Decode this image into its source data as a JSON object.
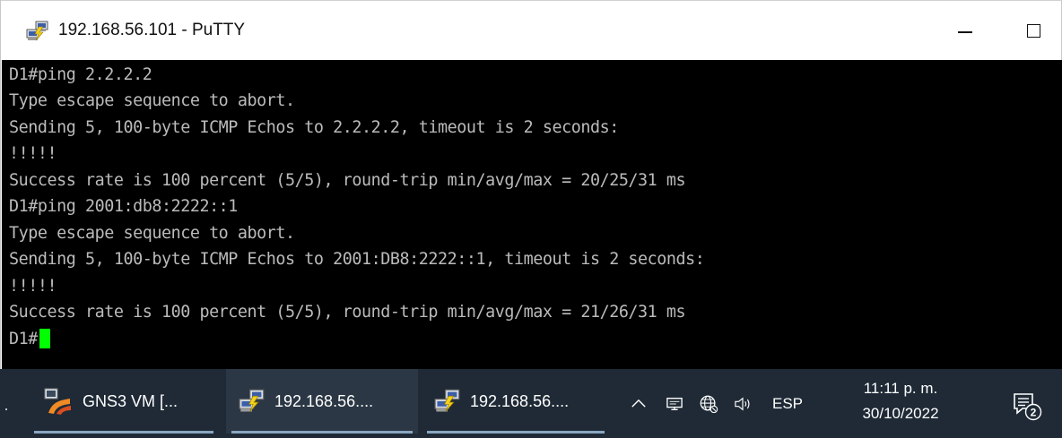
{
  "window": {
    "title": "192.168.56.101 - PuTTY",
    "controls": {
      "minimize_icon": "minimize-icon",
      "maximize_icon": "maximize-icon"
    }
  },
  "terminal": {
    "background": "#000000",
    "text_color": "#bbbbbb",
    "cursor_color": "#00ff00",
    "lines": [
      "D1#ping 2.2.2.2",
      "Type escape sequence to abort.",
      "Sending 5, 100-byte ICMP Echos to 2.2.2.2, timeout is 2 seconds:",
      "!!!!!",
      "Success rate is 100 percent (5/5), round-trip min/avg/max = 20/25/31 ms",
      "D1#ping 2001:db8:2222::1",
      "Type escape sequence to abort.",
      "Sending 5, 100-byte ICMP Echos to 2001:DB8:2222::1, timeout is 2 seconds:",
      "!!!!!",
      "Success rate is 100 percent (5/5), round-trip min/avg/max = 21/26/31 ms"
    ],
    "prompt": "D1#"
  },
  "taskbar": {
    "background": "#1f2a36",
    "items": [
      {
        "label": "GNS3 VM [...",
        "icon": "gns3-icon"
      },
      {
        "label": "192.168.56....",
        "icon": "putty-icon"
      },
      {
        "label": "192.168.56....",
        "icon": "putty-icon"
      }
    ],
    "tray": {
      "chevron_icon": "chevron-up-icon",
      "network_icon": "network-icon",
      "language_icon": "language-globe-icon",
      "volume_icon": "volume-icon",
      "language": "ESP",
      "time": "11:11 p. m.",
      "date": "30/10/2022",
      "notifications_count": "2"
    }
  }
}
